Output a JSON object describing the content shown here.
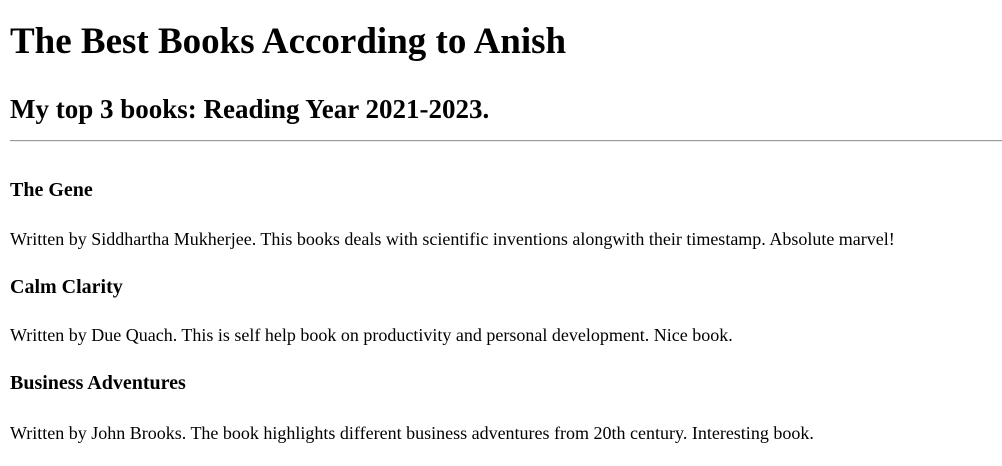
{
  "page_title": "The Best Books According to Anish",
  "subtitle": "My top 3 books: Reading Year 2021-2023.",
  "books": [
    {
      "title": "The Gene",
      "description": "Written by Siddhartha Mukherjee. This books deals with scientific inventions alongwith their timestamp. Absolute marvel!"
    },
    {
      "title": "Calm Clarity",
      "description": "Written by Due Quach. This is self help book on productivity and personal development. Nice book."
    },
    {
      "title": "Business Adventures",
      "description": "Written by John Brooks. The book highlights different business adventures from 20th century. Interesting book."
    }
  ]
}
